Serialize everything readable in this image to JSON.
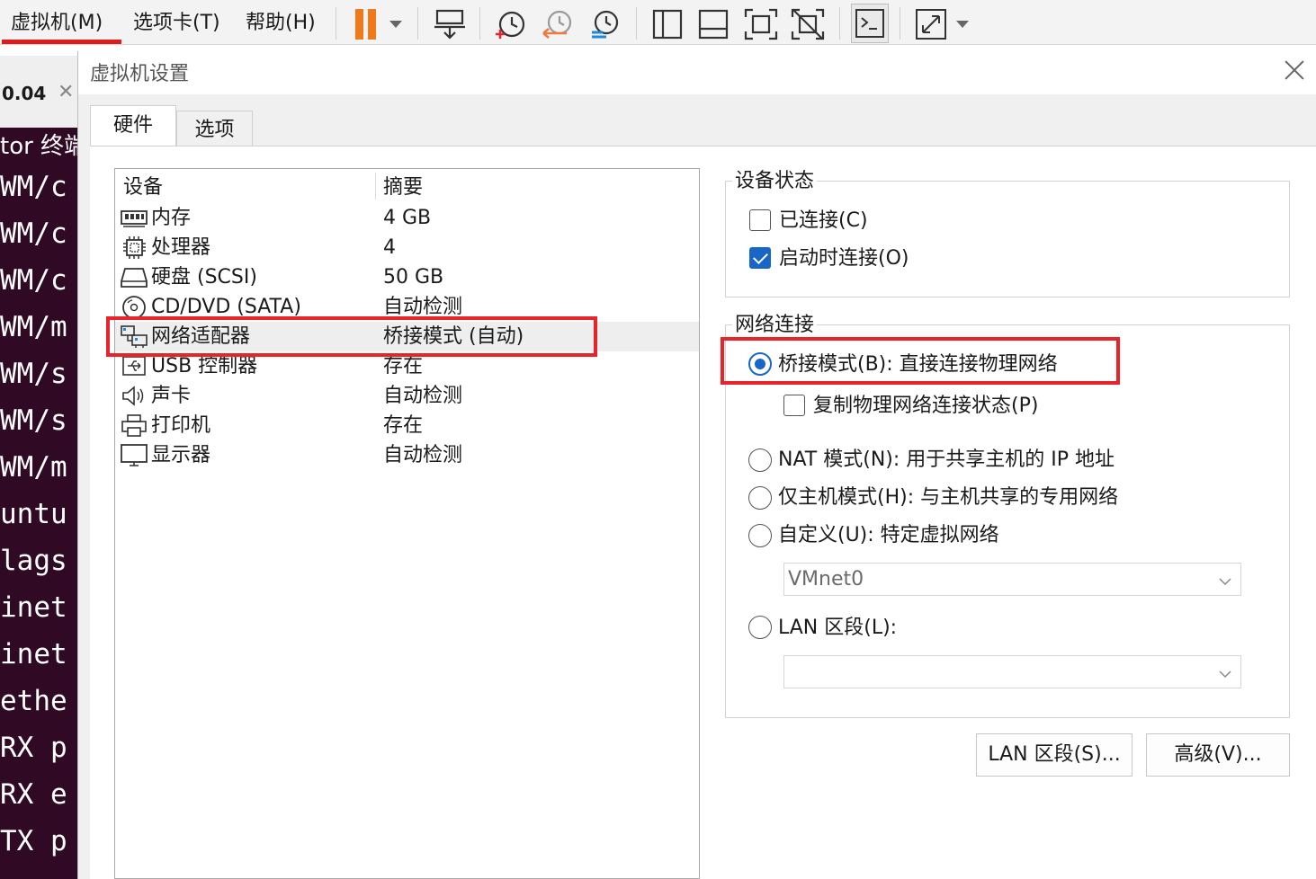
{
  "menubar": {
    "vm_menu": "虚拟机(M)",
    "tabs_menu": "选项卡(T)",
    "help_menu": "帮助(H)"
  },
  "terminal": {
    "tab_title": "0.04",
    "header": "tor 终端",
    "lines": [
      "WM/c",
      "WM/c",
      "WM/c",
      "WM/m",
      "WM/s",
      "WM/s",
      "WM/m",
      "untu",
      "lags",
      "inet",
      "inet",
      "ethe",
      "RX p",
      "RX e",
      "TX p"
    ]
  },
  "dialog": {
    "title": "虚拟机设置",
    "tabs": [
      "硬件",
      "选项"
    ],
    "devices": {
      "col_device": "设备",
      "col_summary": "摘要",
      "rows": [
        {
          "icon": "memory-icon",
          "name": "内存",
          "summary": "4 GB"
        },
        {
          "icon": "cpu-icon",
          "name": "处理器",
          "summary": "4"
        },
        {
          "icon": "harddisk-icon",
          "name": "硬盘 (SCSI)",
          "summary": "50 GB"
        },
        {
          "icon": "cd-dvd-icon",
          "name": "CD/DVD (SATA)",
          "summary": "自动检测"
        },
        {
          "icon": "network-adapter-icon",
          "name": "网络适配器",
          "summary": "桥接模式 (自动)"
        },
        {
          "icon": "usb-icon",
          "name": "USB 控制器",
          "summary": "存在"
        },
        {
          "icon": "sound-icon",
          "name": "声卡",
          "summary": "自动检测"
        },
        {
          "icon": "printer-icon",
          "name": "打印机",
          "summary": "存在"
        },
        {
          "icon": "display-icon",
          "name": "显示器",
          "summary": "自动检测"
        }
      ]
    },
    "device_status": {
      "label": "设备状态",
      "connected": "已连接(C)",
      "connect_on_power": "启动时连接(O)"
    },
    "network": {
      "label": "网络连接",
      "bridged": "桥接模式(B): 直接连接物理网络",
      "replicate": "复制物理网络连接状态(P)",
      "nat": "NAT 模式(N): 用于共享主机的 IP 地址",
      "host_only": "仅主机模式(H): 与主机共享的专用网络",
      "custom": "自定义(U): 特定虚拟网络",
      "custom_select": "VMnet0",
      "lan": "LAN 区段(L):",
      "lan_select": ""
    },
    "buttons": {
      "lan_segments": "LAN 区段(S)...",
      "advanced": "高级(V)..."
    }
  },
  "colors": {
    "accent": "#1866c7",
    "highlight": "#e8242a",
    "terminal_bg": "#300a24",
    "pause": "#f07a1a"
  }
}
